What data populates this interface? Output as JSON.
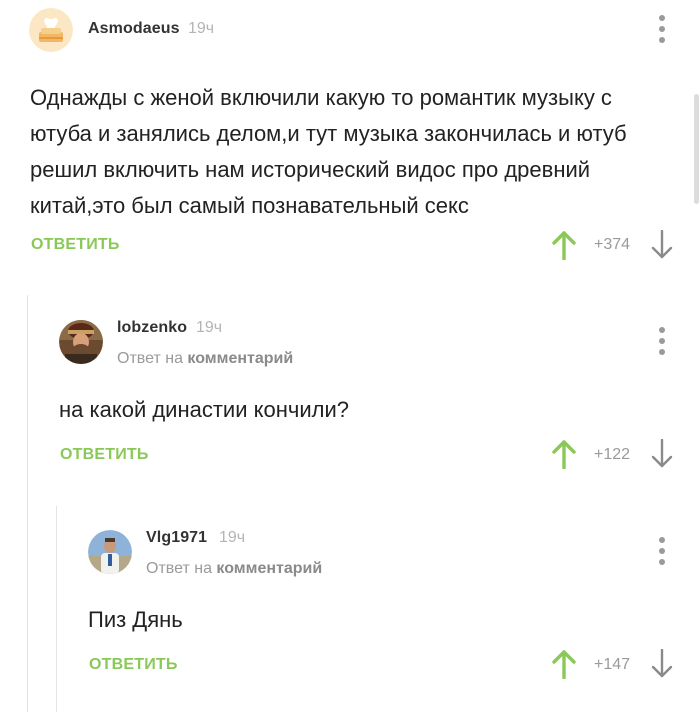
{
  "colors": {
    "accent": "#8ac858",
    "username": "#333333",
    "meta": "#b4b4b4",
    "text": "#222222",
    "arrow_down": "#8a8a8a"
  },
  "comments": [
    {
      "username": "Asmodaeus",
      "time": "19ч",
      "avatar": "cake-avatar",
      "text": "Однажды с женой включили какую то романтик музыку с ютуба и занялись делом,и тут музыка закончилась и ютуб решил включить нам исторический видос про древний китай,это был самый познавательный секс",
      "reply_label": "ОТВЕТИТЬ",
      "rating": "+374"
    },
    {
      "username": "lobzenko",
      "time": "19ч",
      "avatar": "painted-portrait-avatar",
      "reply_prefix": "Ответ на",
      "reply_target": "комментарий",
      "text": "на какой династии кончили?",
      "reply_label": "ОТВЕТИТЬ",
      "rating": "+122"
    },
    {
      "username": "Vlg1971",
      "time": "19ч",
      "avatar": "photo-avatar",
      "reply_prefix": "Ответ на",
      "reply_target": "комментарий",
      "text": "Пиз Дянь",
      "reply_label": "ОТВЕТИТЬ",
      "rating": "+147"
    }
  ]
}
